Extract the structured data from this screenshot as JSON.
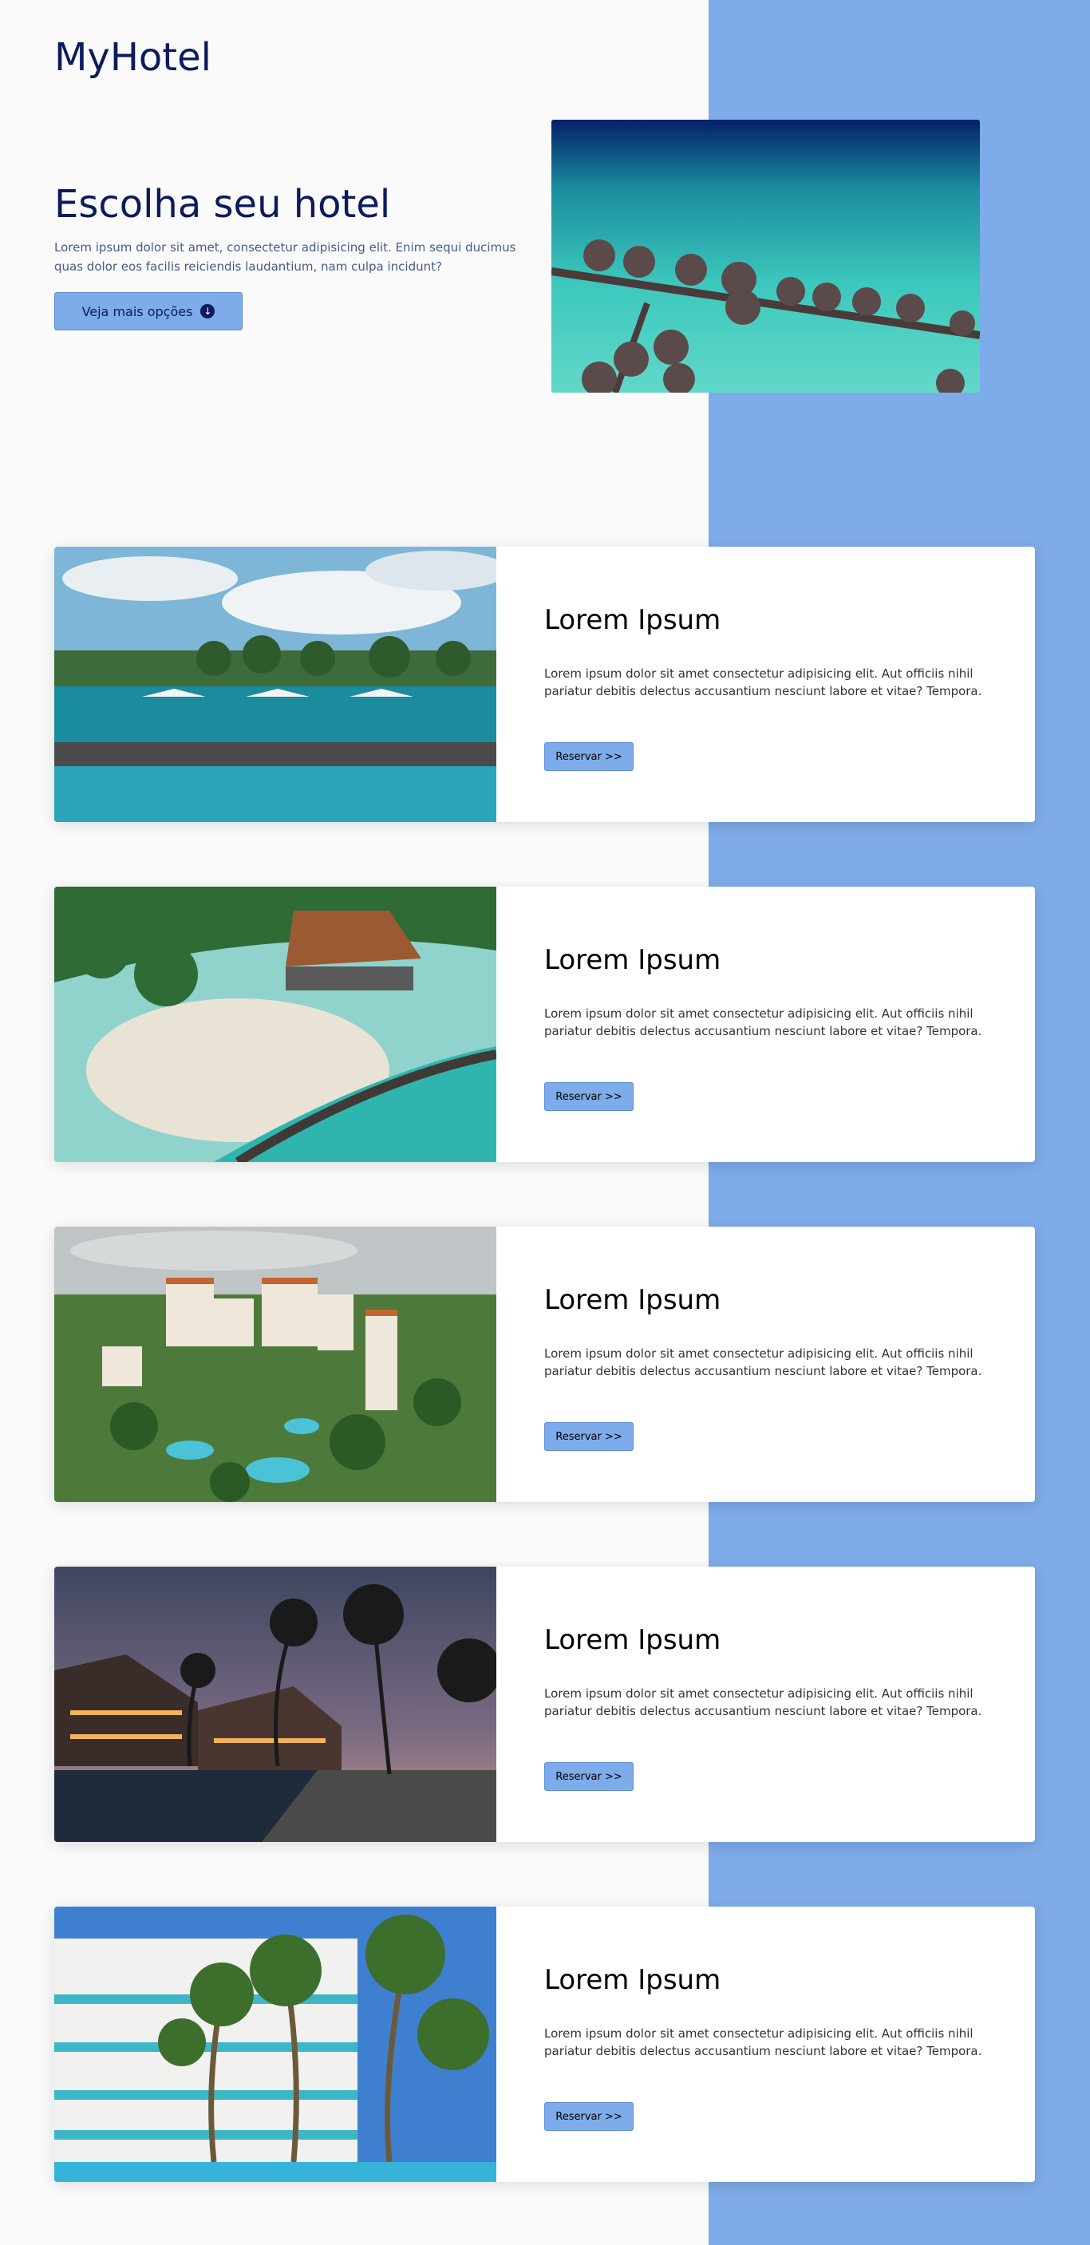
{
  "brand": "MyHotel",
  "hero": {
    "title": "Escolha seu hotel",
    "text": "Lorem ipsum dolor sit amet, consectetur adipisicing elit. Enim sequi ducimus quas dolor eos facilis reiciendis laudantium, nam culpa incidunt?",
    "button_label": "Veja mais opções"
  },
  "hotels": [
    {
      "title": "Lorem Ipsum",
      "text": "Lorem ipsum dolor sit amet consectetur adipisicing elit. Aut officiis nihil pariatur debitis delectus accusantium nesciunt labore et vitae? Tempora.",
      "button_label": "Reservar >>"
    },
    {
      "title": "Lorem Ipsum",
      "text": "Lorem ipsum dolor sit amet consectetur adipisicing elit. Aut officiis nihil pariatur debitis delectus accusantium nesciunt labore et vitae? Tempora.",
      "button_label": "Reservar >>"
    },
    {
      "title": "Lorem Ipsum",
      "text": "Lorem ipsum dolor sit amet consectetur adipisicing elit. Aut officiis nihil pariatur debitis delectus accusantium nesciunt labore et vitae? Tempora.",
      "button_label": "Reservar >>"
    },
    {
      "title": "Lorem Ipsum",
      "text": "Lorem ipsum dolor sit amet consectetur adipisicing elit. Aut officiis nihil pariatur debitis delectus accusantium nesciunt labore et vitae? Tempora.",
      "button_label": "Reservar >>"
    },
    {
      "title": "Lorem Ipsum",
      "text": "Lorem ipsum dolor sit amet consectetur adipisicing elit. Aut officiis nihil pariatur debitis delectus accusantium nesciunt labore et vitae? Tempora.",
      "button_label": "Reservar >>"
    }
  ],
  "colors": {
    "accent": "#7eabe9",
    "heading": "#0d1a5c",
    "background": "#fafafa"
  },
  "icons": {
    "hero_button": "download-circle-icon"
  }
}
